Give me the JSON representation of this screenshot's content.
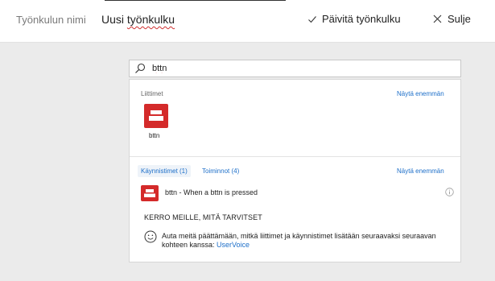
{
  "header": {
    "field_label": "Työnkulun nimi",
    "flow_name_prefix": "Uusi ",
    "flow_name_misspelled": "työnkulku",
    "update_label": "Päivitä työnkulku",
    "close_label": "Sulje"
  },
  "search": {
    "value": "bttn",
    "icon": "search-icon"
  },
  "connectors": {
    "section_label": "Liittimet",
    "more_label": "Näytä enemmän",
    "items": [
      {
        "name": "bttn",
        "color": "#d42a2a",
        "icon": "bttn-icon"
      }
    ]
  },
  "results": {
    "tabs": [
      {
        "label": "Käynnistimet (1)",
        "active": true
      },
      {
        "label": "Toiminnot (4)",
        "active": false
      }
    ],
    "more_label": "Näytä enemmän",
    "items": [
      {
        "label": "bttn - When a bttn is pressed",
        "icon": "bttn-icon",
        "color": "#d42a2a"
      }
    ]
  },
  "feedback": {
    "title": "KERRO MEILLE, MITÄ TARVITSET",
    "text": "Auta meitä päättämään, mitkä liittimet ja käynnistimet lisätään seuraavaksi seuraavan kohteen kanssa: ",
    "link_label": "UserVoice",
    "icon": "smile-icon"
  },
  "colors": {
    "accent": "#1d6fc9",
    "brand_red": "#d42a2a",
    "background": "#ebebeb"
  }
}
